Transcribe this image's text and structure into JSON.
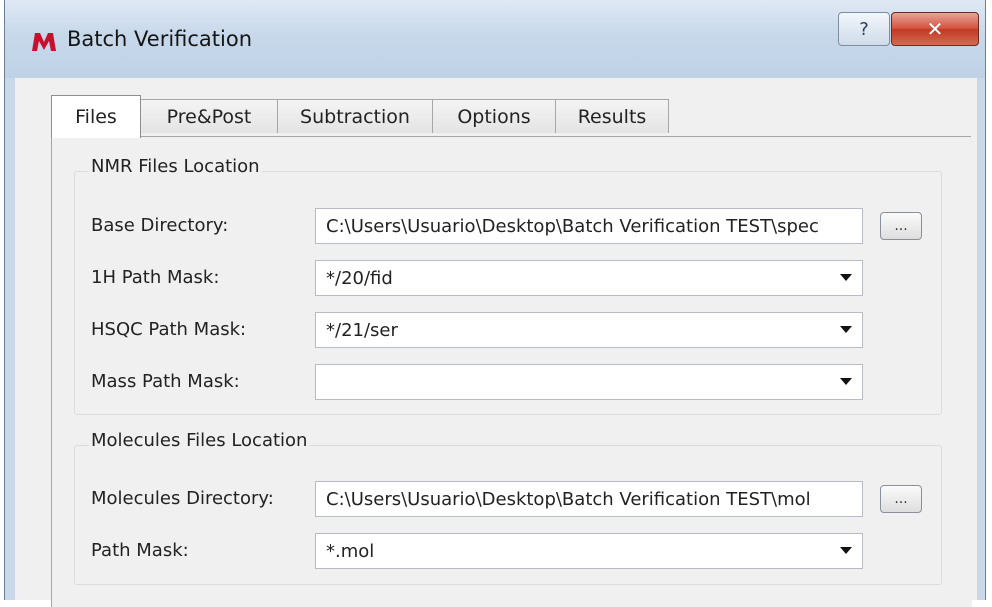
{
  "window": {
    "title": "Batch Verification",
    "help_glyph": "?",
    "close_glyph": "✕"
  },
  "tabs": [
    {
      "label": "Files"
    },
    {
      "label": "Pre&Post"
    },
    {
      "label": "Subtraction"
    },
    {
      "label": "Options"
    },
    {
      "label": "Results"
    }
  ],
  "nmr_group": {
    "title": "NMR Files Location",
    "base_directory": {
      "label": "Base Directory:",
      "value": "C:\\Users\\Usuario\\Desktop\\Batch Verification TEST\\spec"
    },
    "h1_path_mask": {
      "label": "1H Path Mask:",
      "value": "*/20/fid"
    },
    "hsqc_path_mask": {
      "label": "HSQC Path Mask:",
      "value": "*/21/ser"
    },
    "mass_path_mask": {
      "label": "Mass Path Mask:",
      "value": ""
    },
    "browse_label": "..."
  },
  "molecules_group": {
    "title": "Molecules Files Location",
    "molecules_directory": {
      "label": "Molecules Directory:",
      "value": "C:\\Users\\Usuario\\Desktop\\Batch Verification TEST\\mol"
    },
    "path_mask": {
      "label": "Path Mask:",
      "value": "*.mol"
    },
    "browse_label": "..."
  },
  "colors": {
    "title_bar": "#c9d9ea",
    "close_button": "#c23a24",
    "logo": "#c8102e"
  },
  "icons": {
    "app": "mnova-logo-icon",
    "help": "help-icon",
    "close": "close-icon",
    "dropdown": "chevron-down-icon"
  }
}
